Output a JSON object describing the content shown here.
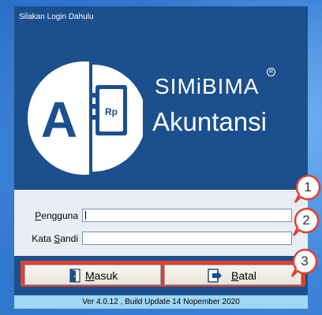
{
  "banner": {
    "prompt": "Silakan Login Dahulu",
    "logo_letter": "A",
    "logo_currency": "Rp",
    "brand_line1": "SIMiBIMA",
    "brand_registered": "R",
    "brand_line2": "Akuntansi"
  },
  "form": {
    "username_label_mnemonic": "P",
    "username_label_rest": "engguna",
    "username_value": "",
    "password_label_prefix": "Kata ",
    "password_label_mnemonic": "S",
    "password_label_rest": "andi",
    "password_value": ""
  },
  "buttons": {
    "login_mnemonic": "M",
    "login_rest": "asuk",
    "cancel_mnemonic": "B",
    "cancel_rest": "atal"
  },
  "footer": {
    "version": "Ver 4.0.12 , Build Update 14 Nopember 2020"
  },
  "callouts": [
    "1",
    "2",
    "3"
  ],
  "colors": {
    "banner": "#1b4f8e",
    "callout_border": "#e0402e",
    "version_bar": "#9ed6f5"
  }
}
